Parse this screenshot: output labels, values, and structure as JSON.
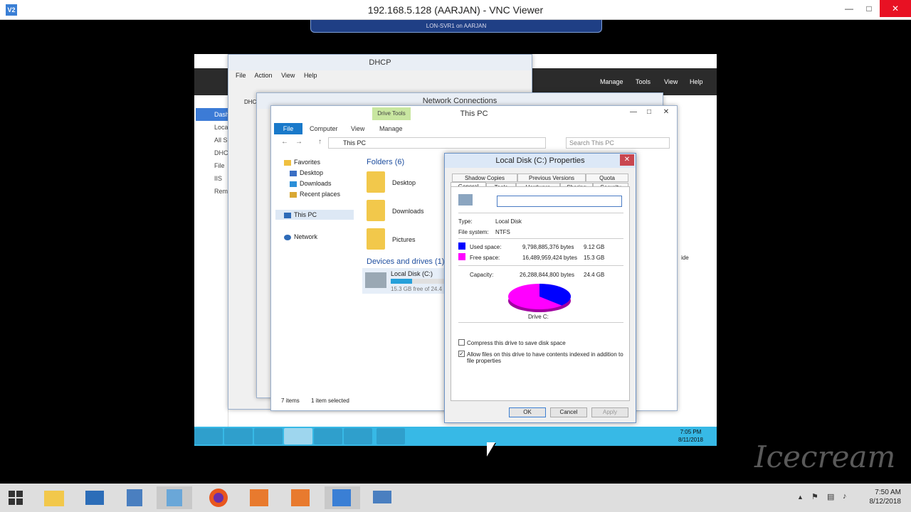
{
  "vnc": {
    "title": "192.168.5.128 (AARJAN) - VNC Viewer",
    "logo": "V2",
    "toolbar_label": "LON-SVR1 on AARJAN"
  },
  "server_manager": {
    "nav": [
      "Dash",
      "Loca",
      "All S",
      "DHC",
      "File",
      "IIS",
      "Rem"
    ],
    "menu": [
      "Manage",
      "Tools",
      "View",
      "Help"
    ],
    "side_text": "ide"
  },
  "dhcp": {
    "title": "DHCP",
    "menu": [
      "File",
      "Action",
      "View",
      "Help"
    ],
    "tree_root": "DHC"
  },
  "network_connections": {
    "title": "Network Connections"
  },
  "explorer": {
    "title": "This PC",
    "drive_tools": "Drive Tools",
    "tabs": [
      "File",
      "Computer",
      "View",
      "Manage"
    ],
    "address": "This PC",
    "search_placeholder": "Search This PC",
    "nav": {
      "favorites": "Favorites",
      "desktop": "Desktop",
      "downloads": "Downloads",
      "recent": "Recent places",
      "this_pc": "This PC",
      "network": "Network"
    },
    "folders_header": "Folders (6)",
    "folders": [
      "Desktop",
      "Downloads",
      "Pictures"
    ],
    "devices_header": "Devices and drives (1)",
    "drive": {
      "name": "Local Disk (C:)",
      "free_text": "15.3 GB free of 24.4",
      "used_fraction": 0.37
    },
    "status_items": "7 items",
    "status_selected": "1 item selected"
  },
  "properties": {
    "title": "Local Disk (C:) Properties",
    "tabs_top": [
      "Shadow Copies",
      "Previous Versions",
      "Quota"
    ],
    "tabs_bottom": [
      "General",
      "Tools",
      "Hardware",
      "Sharing",
      "Security"
    ],
    "type_label": "Type:",
    "type_value": "Local Disk",
    "fs_label": "File system:",
    "fs_value": "NTFS",
    "used_label": "Used space:",
    "used_bytes": "9,798,885,376 bytes",
    "used_gb": "9.12 GB",
    "free_label": "Free space:",
    "free_bytes": "16,489,959,424 bytes",
    "free_gb": "15.3 GB",
    "capacity_label": "Capacity:",
    "capacity_bytes": "26,288,844,800 bytes",
    "capacity_gb": "24.4 GB",
    "drive_label": "Drive C:",
    "compress_label": "Compress this drive to save disk space",
    "index_label": "Allow files on this drive to have contents indexed in addition to file properties",
    "ok": "OK",
    "cancel": "Cancel",
    "apply": "Apply",
    "colors": {
      "used": "#0000ff",
      "free": "#ff00ff"
    }
  },
  "remote_clock": {
    "time": "7:05 PM",
    "date": "8/11/2018"
  },
  "host_clock": {
    "time": "7:50 AM",
    "date": "8/12/2018"
  },
  "watermark": "Icecream"
}
